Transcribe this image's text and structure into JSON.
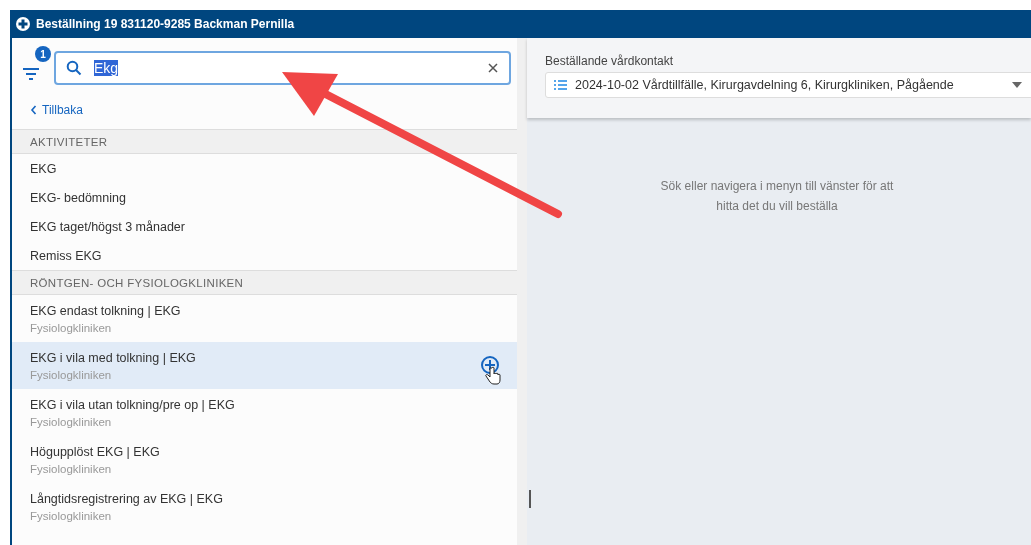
{
  "window": {
    "title": "Beställning 19 831120-9285 Backman Pernilla"
  },
  "search": {
    "filter_count": "1",
    "value": "Ekg",
    "value_selected": true
  },
  "back_link": "Tillbaka",
  "sections": [
    {
      "header": "AKTIVITETER",
      "items": [
        {
          "title": "EKG",
          "hovered": false
        },
        {
          "title": "EKG- bedömning",
          "hovered": false
        },
        {
          "title": "EKG taget/högst 3 månader",
          "hovered": false
        },
        {
          "title": "Remiss EKG",
          "hovered": false
        }
      ]
    },
    {
      "header": "RÖNTGEN- OCH FYSIOLOGKLINIKEN",
      "items": [
        {
          "title": "EKG endast tolkning | EKG",
          "subtitle": "Fysiologkliniken",
          "hovered": false
        },
        {
          "title": "EKG i vila med tolkning | EKG",
          "subtitle": "Fysiologkliniken",
          "hovered": true
        },
        {
          "title": "EKG i vila utan tolkning/pre op | EKG",
          "subtitle": "Fysiologkliniken",
          "hovered": false
        },
        {
          "title": "Högupplöst EKG | EKG",
          "subtitle": "Fysiologkliniken",
          "hovered": false
        },
        {
          "title": "Långtidsregistrering av EKG | EKG",
          "subtitle": "Fysiologkliniken",
          "hovered": false
        }
      ]
    }
  ],
  "care_contact": {
    "label": "Beställande vårdkontakt",
    "value": "2024-10-02 Vårdtillfälle, Kirurgavdelning 6, Kirurgkliniken, Pågående"
  },
  "empty_message": "Sök eller navigera i menyn till vänster för att hitta det du vill beställa"
}
